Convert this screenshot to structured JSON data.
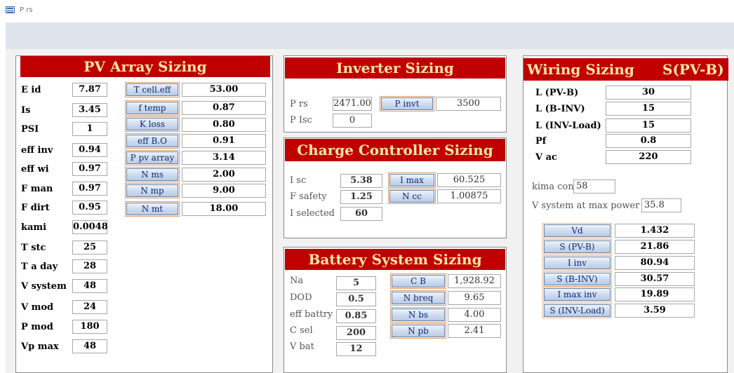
{
  "window": {
    "title": "P rs"
  },
  "pv": {
    "banner": "PV Array Sizing",
    "inputs": [
      {
        "label": "E id",
        "value": "7.87"
      },
      {
        "label": "Is",
        "value": "3.45"
      },
      {
        "label": "PSI",
        "value": "1"
      },
      {
        "label": "eff inv",
        "value": "0.94"
      },
      {
        "label": "eff wi",
        "value": "0.97"
      },
      {
        "label": "F man",
        "value": "0.97"
      },
      {
        "label": "F dirt",
        "value": "0.95"
      },
      {
        "label": "kami",
        "value": "0.0048"
      },
      {
        "label": "T stc",
        "value": "25"
      },
      {
        "label": "T a day",
        "value": "28"
      },
      {
        "label": "V system",
        "value": "48"
      },
      {
        "label": "V mod",
        "value": "24"
      },
      {
        "label": "P mod",
        "value": "180"
      },
      {
        "label": "Vp max",
        "value": "48"
      }
    ],
    "calcs": [
      {
        "button": "T cell.eff",
        "value": "53.00"
      },
      {
        "button": "f temp",
        "value": "0.87"
      },
      {
        "button": "K loss",
        "value": "0.80"
      },
      {
        "button": "eff B.O",
        "value": "0.91"
      },
      {
        "button": "P pv array",
        "value": "3.14"
      },
      {
        "button": "N ms",
        "value": "2.00"
      },
      {
        "button": "N mp",
        "value": "9.00"
      },
      {
        "button": "N mt",
        "value": "18.00"
      }
    ]
  },
  "inverter": {
    "banner": "Inverter Sizing",
    "prs_label": "P rs",
    "prs_value": "2471.00",
    "pisc_label": "P Isc",
    "pisc_value": "0",
    "button": "P invt",
    "invt_value": "3500"
  },
  "charge": {
    "banner": "Charge Controller Sizing",
    "isc_label": "I sc",
    "isc_value": "5.38",
    "fsafety_label": "F safety",
    "fsafety_value": "1.25",
    "isel_label": "I selected",
    "isel_value": "60",
    "imax_button": "I max",
    "imax_value": "60.525",
    "ncc_button": "N cc",
    "ncc_value": "1.00875"
  },
  "battery": {
    "banner": "Battery System Sizing",
    "inputs": [
      {
        "label": "Na",
        "value": "5"
      },
      {
        "label": "DOD",
        "value": "0.5"
      },
      {
        "label": "eff battry",
        "value": "0.85"
      },
      {
        "label": "C sel",
        "value": "200"
      },
      {
        "label": "V bat",
        "value": "12"
      }
    ],
    "calcs": [
      {
        "button": "C B",
        "value": "1,928.92"
      },
      {
        "button": "N breq",
        "value": "9.65"
      },
      {
        "button": "N bs",
        "value": "4.00"
      },
      {
        "button": "N pb",
        "value": "2.41"
      }
    ]
  },
  "wiring": {
    "banner_left": "Wiring Sizing",
    "banner_right": "S(PV-B)",
    "inputs": [
      {
        "label": "L (PV-B)",
        "value": "30"
      },
      {
        "label": "L (B-INV)",
        "value": "15"
      },
      {
        "label": "L (INV-Load)",
        "value": "15"
      },
      {
        "label": "Pf",
        "value": "0.8"
      },
      {
        "label": "V ac",
        "value": "220"
      }
    ],
    "kima_label": "kima con",
    "kima_value": "58",
    "vsys_label": "V system at max power",
    "vsys_value": "35.8",
    "calcs": [
      {
        "button": "Vd",
        "value": "1.432"
      },
      {
        "button": "S (PV-B)",
        "value": "21.86"
      },
      {
        "button": "I inv",
        "value": "80.94"
      },
      {
        "button": "S (B-INV)",
        "value": "30.57"
      },
      {
        "button": "I max inv",
        "value": "19.89"
      },
      {
        "button": "S (INV-Load)",
        "value": "3.59"
      }
    ]
  }
}
